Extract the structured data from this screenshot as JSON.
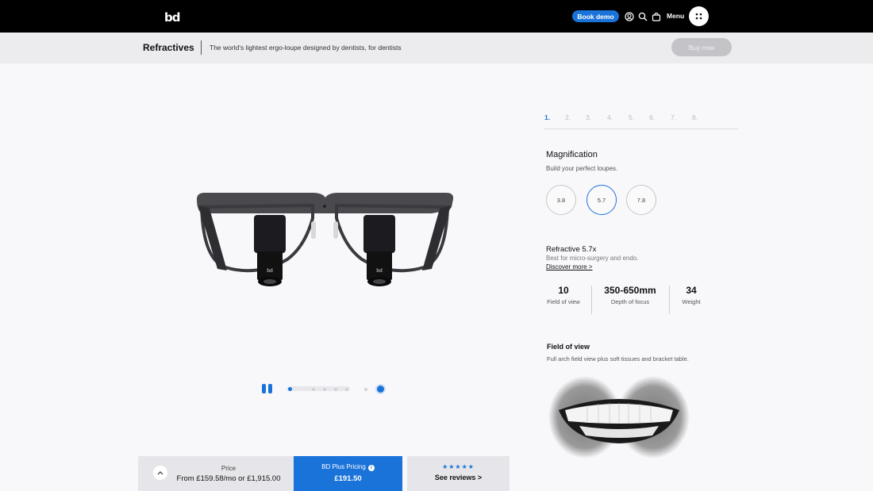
{
  "brand": {
    "logo_text": "bd"
  },
  "nav": {
    "book_demo": "Book demo",
    "menu_label": "Menu",
    "icons": [
      "account-icon",
      "search-icon",
      "basket-icon",
      "grid-dots-icon"
    ]
  },
  "subnav": {
    "title": "Refractives",
    "tagline": "The world's lightest ergo-loupe designed by dentists, for dentists",
    "buy_now": "Buy now"
  },
  "steps": [
    "1.",
    "2.",
    "3.",
    "4.",
    "5.",
    "6.",
    "7.",
    "8."
  ],
  "active_step": 0,
  "magnification": {
    "heading": "Magnification",
    "subtext": "Build your perfect loupes.",
    "options": [
      "3.8",
      "5.7",
      "7.8"
    ],
    "selected": "5.7"
  },
  "product": {
    "name": "Refractive 5.7x",
    "description": "Best for micro-surgery and endo.",
    "discover_link": "Discover more >"
  },
  "specs": [
    {
      "value": "10",
      "label": "Field of view"
    },
    {
      "value": "350-650mm",
      "label": "Depth of focus"
    },
    {
      "value": "34",
      "label": "Weight"
    }
  ],
  "field_of_view": {
    "heading": "Field of view",
    "description": "Full arch field view plus soft tissues and bracket table."
  },
  "carousel": {
    "slide_count": 6,
    "active_index": 0
  },
  "pricing": {
    "price_label": "Price",
    "price_value": "From £159.58/mo or £1,915.00",
    "plus_label": "BD Plus Pricing",
    "plus_info": "i",
    "plus_value": "£191.50",
    "stars": "★★★★★",
    "reviews": "See reviews >"
  },
  "colors": {
    "accent": "#1a73d9",
    "topbar": "#000000",
    "subbar": "#ececee"
  }
}
